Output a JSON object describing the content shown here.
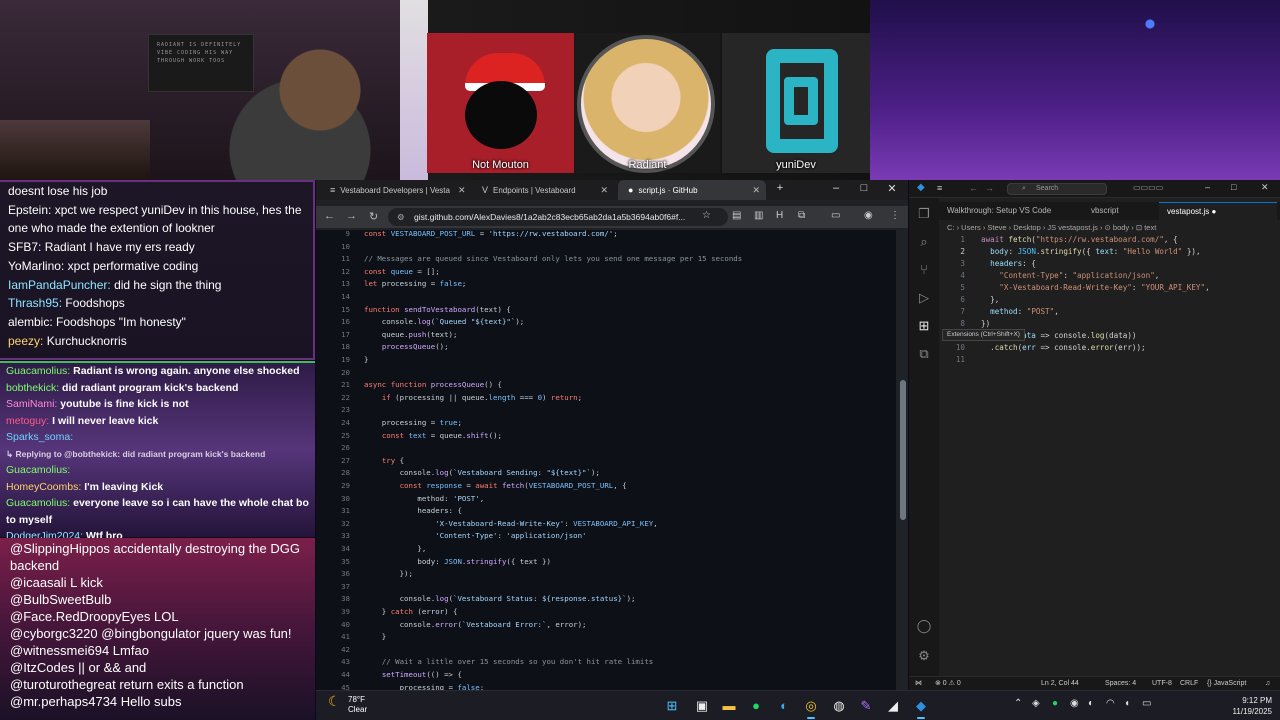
{
  "stream": {
    "poster_text": "RADIANT IS DEFINITELY VIBE CODING HIS WAY THROUGH WORK TOOS",
    "tiles": [
      {
        "label": "Not Mouton"
      },
      {
        "label": "Radiant"
      },
      {
        "label": "yuniDev"
      }
    ]
  },
  "chat_top": [
    {
      "user": "",
      "user_color": "#ffffff",
      "text": "doesnt lose his job"
    },
    {
      "user": "Epstein:",
      "user_color": "#ffffff",
      "text": " xpct we respect yuniDev in this house, hes the"
    },
    {
      "user": "",
      "user_color": "#ffffff",
      "text": "one who made the extention of lookner"
    },
    {
      "user": "SFB7:",
      "user_color": "#ffffff",
      "text": " Radiant I have my   ers ready"
    },
    {
      "user": "YoMarlino:",
      "user_color": "#ffffff",
      "text": " xpct performative coding"
    },
    {
      "user": "IamPandaPuncher:",
      "user_color": "#8ee4ff",
      "text": " did he sign the thing"
    },
    {
      "user": "Thrash95:",
      "user_color": "#8ee4ff",
      "text": " Foodshops"
    },
    {
      "user": "alembic:",
      "user_color": "#ffffff",
      "text": " Foodshops \"Im honesty\""
    },
    {
      "user": "peezy:",
      "user_color": "#ffd36b",
      "text": " Kurchucknorris"
    }
  ],
  "chat_mid": [
    {
      "user": "Guacamolius:",
      "user_color": "#7cff6b",
      "text": " Radiant is wrong again. anyone else shocked",
      "reply": false
    },
    {
      "user": "bobthekick:",
      "user_color": "#7cff6b",
      "text": " did radiant program kick's backend",
      "reply": false
    },
    {
      "user": "SamiNami:",
      "user_color": "#ff8ad8",
      "text": " youtube is fine kick is not",
      "reply": false
    },
    {
      "user": "metoguy:",
      "user_color": "#ff5a8a",
      "text": " I will never leave kick",
      "reply": false
    },
    {
      "user": "Sparks_soma:",
      "user_color": "#6bd6ff",
      "text": "",
      "reply": false
    },
    {
      "user": "",
      "user_color": "#d8d0e0",
      "text": "↳ Replying to @bobthekick: did radiant program kick's backend",
      "reply": true
    },
    {
      "user": "Guacamolius:",
      "user_color": "#7cff6b",
      "text": "",
      "reply": false
    },
    {
      "user": "HomeyCoombs:",
      "user_color": "#ffd36b",
      "text": " I'm leaving Kick",
      "reply": false
    },
    {
      "user": "Guacamolius:",
      "user_color": "#7cff6b",
      "text": " everyone leave so i can have the whole chat box",
      "reply": false
    },
    {
      "user": "",
      "user_color": "#ffffff",
      "text": "to myself",
      "reply": false
    },
    {
      "user": "DodgerJim2024:",
      "user_color": "#8ee4ff",
      "text": " Wtf bro",
      "reply": false
    }
  ],
  "chat_bottom": [
    {
      "user": "@SlippingHippos",
      "text": " accidentally destroying the DGG backend"
    },
    {
      "user": "@icaasali",
      "text": " L kick"
    },
    {
      "user": "@BulbSweetBulb",
      "text": ""
    },
    {
      "user": "@Face.RedDroopyEyes",
      "text": " LOL"
    },
    {
      "user": "@cyborgc3220",
      "text": " @bingbongulator jquery was fun!"
    },
    {
      "user": "@witnessmei694",
      "text": " Lmfao"
    },
    {
      "user": "@ItzCodes",
      "text": " || or && and"
    },
    {
      "user": "@turoturothegreat",
      "text": " return exits a function"
    },
    {
      "user": "@mr.perhaps4734",
      "text": " Hello subs"
    }
  ],
  "chrome": {
    "tabs": [
      {
        "label": "Vestaboard Developers | Vesta",
        "icon": "hamburger-icon"
      },
      {
        "label": "Endpoints | Vestaboard",
        "icon": "v-icon"
      },
      {
        "label": "script.js · GitHub",
        "icon": "github-icon"
      }
    ],
    "url": "gist.github.com/AlexDavies8/1a2ab2c83ecb65ab2da1a5b3694ab0f6#f...",
    "code_lines": [
      {
        "n": "9",
        "html": "<span class=\"kw\">const</span> <span class=\"cst\">VESTABOARD_POST_URL</span> = <span class=\"str\">'https://rw.vestaboard.com/'</span>;"
      },
      {
        "n": "10",
        "html": ""
      },
      {
        "n": "11",
        "html": "<span class=\"cm\">// Messages are queued since Vestaboard only lets you send one message per 15 seconds</span>"
      },
      {
        "n": "12",
        "html": "<span class=\"kw\">const</span> <span class=\"cst\">queue</span> = [];"
      },
      {
        "n": "13",
        "html": "<span class=\"kw\">let</span> processing = <span class=\"cst\">false</span>;"
      },
      {
        "n": "14",
        "html": ""
      },
      {
        "n": "15",
        "html": "<span class=\"kw\">function</span> <span class=\"fn\">sendToVestaboard</span>(text) {"
      },
      {
        "n": "16",
        "html": "    console.<span class=\"fn\">log</span>(<span class=\"str\">`Queued \"${text}\"`</span>);"
      },
      {
        "n": "17",
        "html": "    queue.<span class=\"fn\">push</span>(text);"
      },
      {
        "n": "18",
        "html": "    <span class=\"fn\">processQueue</span>();"
      },
      {
        "n": "19",
        "html": "}"
      },
      {
        "n": "20",
        "html": ""
      },
      {
        "n": "21",
        "html": "<span class=\"kw\">async function</span> <span class=\"fn\">processQueue</span>() {"
      },
      {
        "n": "22",
        "html": "    <span class=\"kw\">if</span> (processing || queue.<span class=\"cst\">length</span> === <span class=\"cst\">0</span>) <span class=\"kw\">return</span>;"
      },
      {
        "n": "23",
        "html": ""
      },
      {
        "n": "24",
        "html": "    processing = <span class=\"cst\">true</span>;"
      },
      {
        "n": "25",
        "html": "    <span class=\"kw\">const</span> <span class=\"cst\">text</span> = queue.<span class=\"fn\">shift</span>();"
      },
      {
        "n": "26",
        "html": ""
      },
      {
        "n": "27",
        "html": "    <span class=\"kw\">try</span> {"
      },
      {
        "n": "28",
        "html": "        console.<span class=\"fn\">log</span>(<span class=\"str\">`Vestaboard Sending: \"${text}\"`</span>);"
      },
      {
        "n": "29",
        "html": "        <span class=\"kw\">const</span> <span class=\"cst\">response</span> = <span class=\"kw\">await</span> <span class=\"fn\">fetch</span>(<span class=\"cst\">VESTABOARD_POST_URL</span>, {"
      },
      {
        "n": "30",
        "html": "            method: <span class=\"str\">'POST'</span>,"
      },
      {
        "n": "31",
        "html": "            headers: {"
      },
      {
        "n": "32",
        "html": "                <span class=\"str\">'X-Vestaboard-Read-Write-Key'</span>: <span class=\"cst\">VESTABOARD_API_KEY</span>,"
      },
      {
        "n": "33",
        "html": "                <span class=\"str\">'Content-Type'</span>: <span class=\"str\">'application/json'</span>"
      },
      {
        "n": "34",
        "html": "            },"
      },
      {
        "n": "35",
        "html": "            body: <span class=\"cst\">JSON</span>.<span class=\"fn\">stringify</span>({ text })"
      },
      {
        "n": "36",
        "html": "        });"
      },
      {
        "n": "37",
        "html": ""
      },
      {
        "n": "38",
        "html": "        console.<span class=\"fn\">log</span>(<span class=\"str\">`Vestaboard Status: ${response.status}`</span>);"
      },
      {
        "n": "39",
        "html": "    } <span class=\"kw\">catch</span> (error) {"
      },
      {
        "n": "40",
        "html": "        console.<span class=\"fn\">error</span>(<span class=\"str\">`Vestaboard Error:`</span>, error);"
      },
      {
        "n": "41",
        "html": "    }"
      },
      {
        "n": "42",
        "html": ""
      },
      {
        "n": "43",
        "html": "    <span class=\"cm\">// Wait a little over 15 seconds so you don't hit rate limits</span>"
      },
      {
        "n": "44",
        "html": "    <span class=\"fn\">setTimeout</span>(() => {"
      },
      {
        "n": "45",
        "html": "        processing = <span class=\"cst\">false</span>;"
      }
    ]
  },
  "vscode": {
    "search_placeholder": "Search",
    "tabs": [
      {
        "label": "Walkthrough: Setup VS Code"
      },
      {
        "label": "vbscript"
      },
      {
        "label": "vestapost.js ●"
      }
    ],
    "breadcrumb": "C: › Users › Steve › Desktop › JS vestapost.js › ⊙ body › ⊡ text",
    "tooltip": "Extensions (Ctrl+Shift+X)",
    "lines": [
      {
        "n": "1",
        "html": "<span class=\"v-kw\">await</span> <span class=\"v-fn\">fetch</span>(<span class=\"v-str\">\"https://rw.vestaboard.com/\"</span>, {"
      },
      {
        "n": "2",
        "html": "  <span class=\"v-prop\">body</span>: <span class=\"v-cst\">JSON</span>.<span class=\"v-fn\">stringify</span>({ <span class=\"v-prop\">text</span>: <span class=\"v-str\">\"Hello World\"</span> }),"
      },
      {
        "n": "3",
        "html": "  <span class=\"v-prop\">headers</span>: {"
      },
      {
        "n": "4",
        "html": "    <span class=\"v-str\">\"Content-Type\"</span>: <span class=\"v-str\">\"application/json\"</span>,"
      },
      {
        "n": "5",
        "html": "    <span class=\"v-str\">\"X-Vestaboard-Read-Write-Key\"</span>: <span class=\"v-str\">\"YOUR_API_KEY\"</span>,"
      },
      {
        "n": "6",
        "html": "  },"
      },
      {
        "n": "7",
        "html": "  <span class=\"v-prop\">method</span>: <span class=\"v-str\">\"POST\"</span>,"
      },
      {
        "n": "8",
        "html": "})"
      },
      {
        "n": "9",
        "html": "  .<span class=\"v-fn\">then</span>(<span class=\"v-prop\">data</span> => console.<span class=\"v-fn\">log</span>(data))"
      },
      {
        "n": "10",
        "html": "  .<span class=\"v-fn\">catch</span>(<span class=\"v-prop\">err</span> => console.<span class=\"v-fn\">error</span>(err));"
      },
      {
        "n": "11",
        "html": ""
      }
    ],
    "status": {
      "errors": "⊗ 0 ⚠ 0",
      "position": "Ln 2, Col 44",
      "spaces": "Spaces: 4",
      "encoding": "UTF-8",
      "eol": "CRLF",
      "language": "{} JavaScript"
    }
  },
  "taskbar": {
    "temp": "78°F",
    "condition": "Clear",
    "time": "9:12 PM",
    "date": "11/19/2025"
  }
}
